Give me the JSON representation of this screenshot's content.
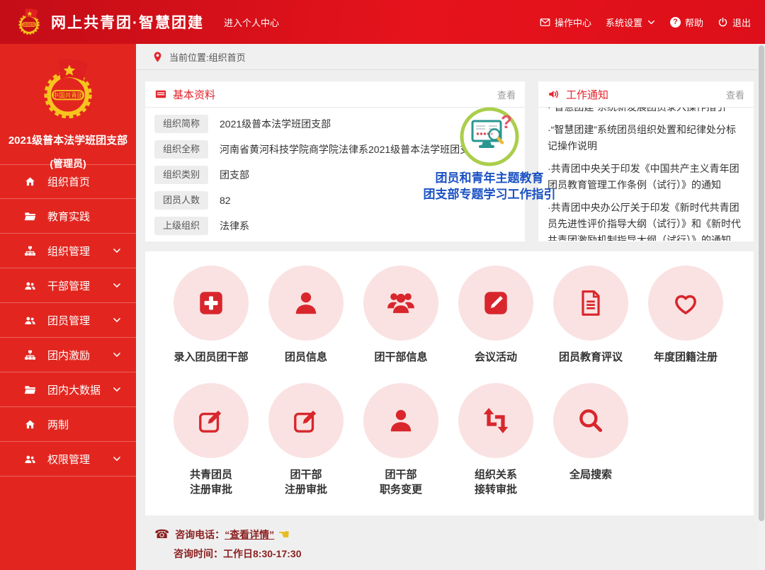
{
  "app": {
    "title": "网上共青团·智慧团建",
    "personal": "进入个人中心"
  },
  "hmenu": {
    "ops": "操作中心",
    "settings": "系统设置",
    "help": "帮助",
    "logout": "退出"
  },
  "sidebar": {
    "org_name": "2021级普本法学班团支部",
    "role": "(管理员)",
    "items": [
      {
        "label": "组织首页"
      },
      {
        "label": "教育实践"
      },
      {
        "label": "组织管理"
      },
      {
        "label": "干部管理"
      },
      {
        "label": "团员管理"
      },
      {
        "label": "团内激励"
      },
      {
        "label": "团内大数据"
      },
      {
        "label": "两制"
      },
      {
        "label": "权限管理"
      }
    ]
  },
  "breadcrumb": {
    "label": "当前位置:组织首页"
  },
  "basic": {
    "title": "基本资料",
    "view": "查看",
    "rows": [
      {
        "label": "组织简称",
        "value": "2021级普本法学班团支部"
      },
      {
        "label": "组织全称",
        "value": "河南省黄河科技学院商学院法律系2021级普本法学班团支部"
      },
      {
        "label": "组织类别",
        "value": "团支部"
      },
      {
        "label": "团员人数",
        "value": "82"
      },
      {
        "label": "上级组织",
        "value": "法律系"
      }
    ]
  },
  "notice": {
    "title": "工作通知",
    "view": "查看",
    "items": [
      "·“智慧团建”系统新发展团员录入操作指引",
      "·“智慧团建”系统团员组织处置和纪律处分标记操作说明",
      "·共青团中央关于印发《中国共产主义青年团团员教育管理工作条例（试行）》的通知",
      "·共青团中央办公厅关于印发《新时代共青团员先进性评价指导大纲（试行）》和《新时代共青团激励机制指导大纲（试行）》的通知"
    ]
  },
  "promo": {
    "line1": "团员和青年主题教育",
    "line2": "团支部专题学习工作指引"
  },
  "grid": {
    "items": [
      {
        "l1": "录入团员团干部"
      },
      {
        "l1": "团员信息"
      },
      {
        "l1": "团干部信息"
      },
      {
        "l1": "会议活动"
      },
      {
        "l1": "团员教育评议"
      },
      {
        "l1": "年度团籍注册"
      },
      {
        "l1": "共青团员",
        "l2": "注册审批"
      },
      {
        "l1": "团干部",
        "l2": "注册审批"
      },
      {
        "l1": "团干部",
        "l2": "职务变更"
      },
      {
        "l1": "组织关系",
        "l2": "接转审批"
      },
      {
        "l1": "全局搜索"
      }
    ]
  },
  "footer": {
    "phone_label": "咨询电话：",
    "phone_value": "“查看详情”",
    "time_label": "咨询时间：",
    "time_value": "工作日8:30-17:30"
  },
  "colors": {
    "primary_red": "#e0131c",
    "sidebar_red": "#e2261f",
    "icon_red": "#d8262c",
    "circle_pink": "#fae2e2",
    "promo_blue": "#1b52c3",
    "footer_maroon": "#8b1f1f"
  }
}
